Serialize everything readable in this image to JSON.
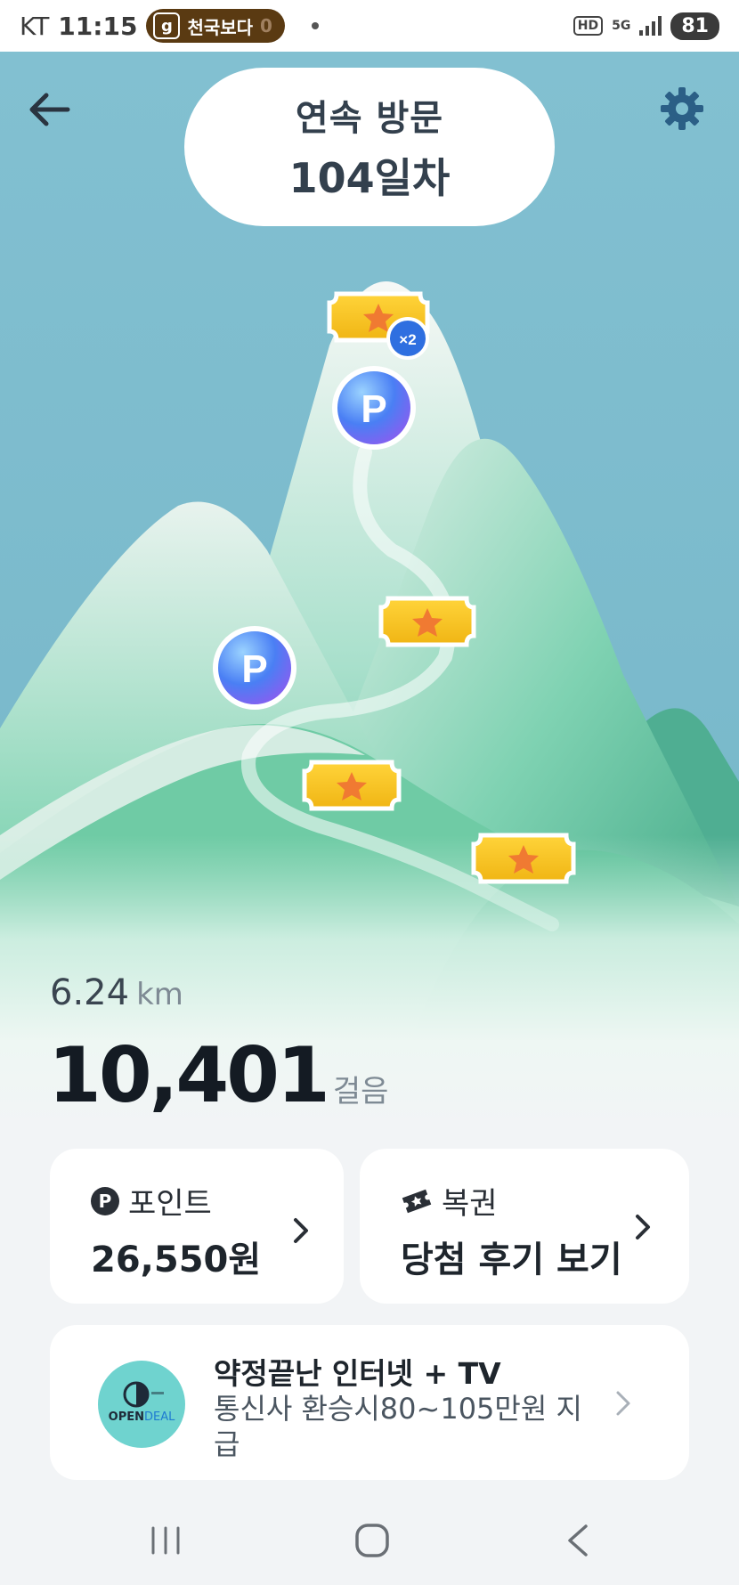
{
  "status_bar": {
    "carrier": "KT",
    "time": "11:15",
    "pill_icon": "g",
    "pill_label": "천국보다",
    "pill_trail": "0",
    "hd": "HD",
    "network": "5G",
    "battery": "81"
  },
  "header": {
    "visit_label": "연속 방문",
    "visit_days": "104일차",
    "back_icon": "arrow-left-icon",
    "settings_icon": "gear-icon"
  },
  "map": {
    "multiplier_badge": "×2",
    "point_marker": "P",
    "colors": {
      "sky": "#7fbfd0",
      "mountain": "#5ccaa4",
      "ticket": "#f2c21b",
      "point_blue": "#3e7cf5"
    }
  },
  "stats": {
    "distance_value": "6.24",
    "distance_unit": "km",
    "steps_value": "10,401",
    "steps_unit": "걸음"
  },
  "cards": {
    "points": {
      "badge": "P",
      "title": "포인트",
      "value": "26,550원"
    },
    "lottery": {
      "icon": "ticket-icon",
      "title": "복권",
      "value": "당첨 후기 보기"
    }
  },
  "ad": {
    "logo_prefix": "OPEN",
    "logo_suffix": "DEAL",
    "title": "약정끝난 인터넷 + TV",
    "subtitle": "통신사 환승시80~105만원 지급"
  },
  "nav": {
    "recent_icon": "recent-apps-icon",
    "home_icon": "home-icon",
    "back_icon": "back-icon"
  }
}
